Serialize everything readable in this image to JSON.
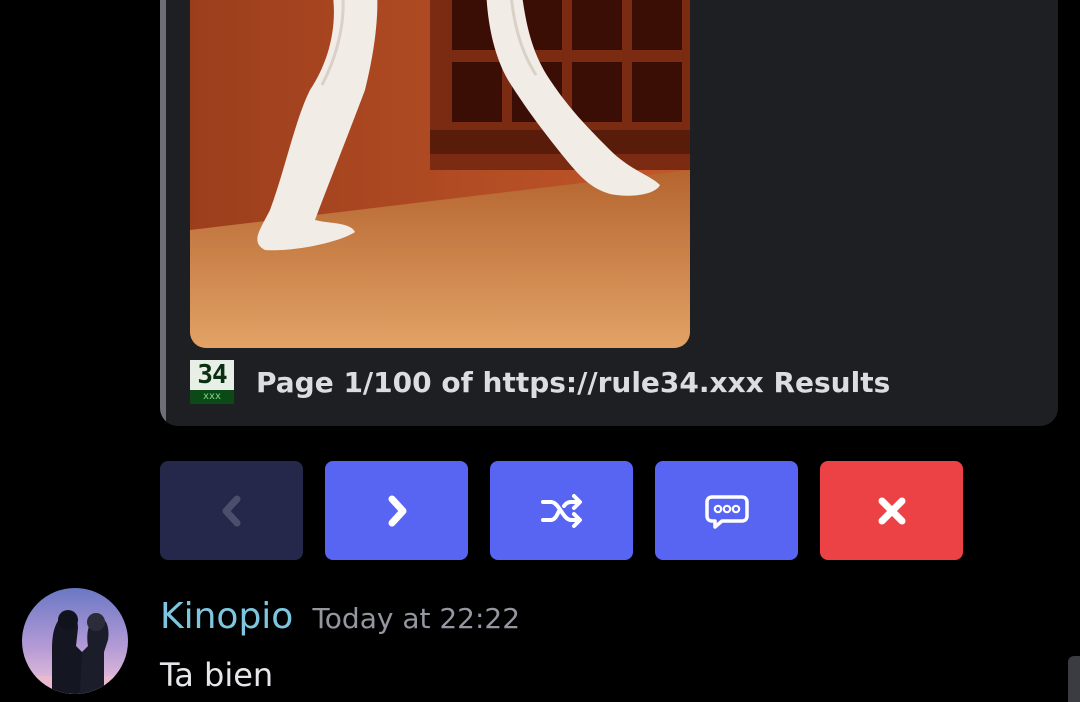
{
  "embed": {
    "footer_icon": {
      "number": "34",
      "sub": "xxx"
    },
    "footer_text": "Page 1/100 of https://rule34.xxx Results",
    "image_icon": "embed-image"
  },
  "buttons": [
    {
      "name": "previous",
      "icon": "chevron-left-icon",
      "color": "#25284a"
    },
    {
      "name": "next",
      "icon": "chevron-right-icon",
      "color": "#5865f2"
    },
    {
      "name": "shuffle",
      "icon": "shuffle-icon",
      "color": "#5865f2"
    },
    {
      "name": "comments",
      "icon": "speech-bubble-icon",
      "color": "#5865f2"
    },
    {
      "name": "close",
      "icon": "close-icon",
      "color": "#ed4245"
    }
  ],
  "message": {
    "username": "Kinopio",
    "timestamp": "Today at 22:22",
    "text": "Ta bien",
    "username_color": "#7ec6df"
  },
  "theme": {
    "background": "#000000",
    "embed_background": "#1e1f22",
    "blurple": "#5865f2",
    "danger": "#ed4245"
  }
}
